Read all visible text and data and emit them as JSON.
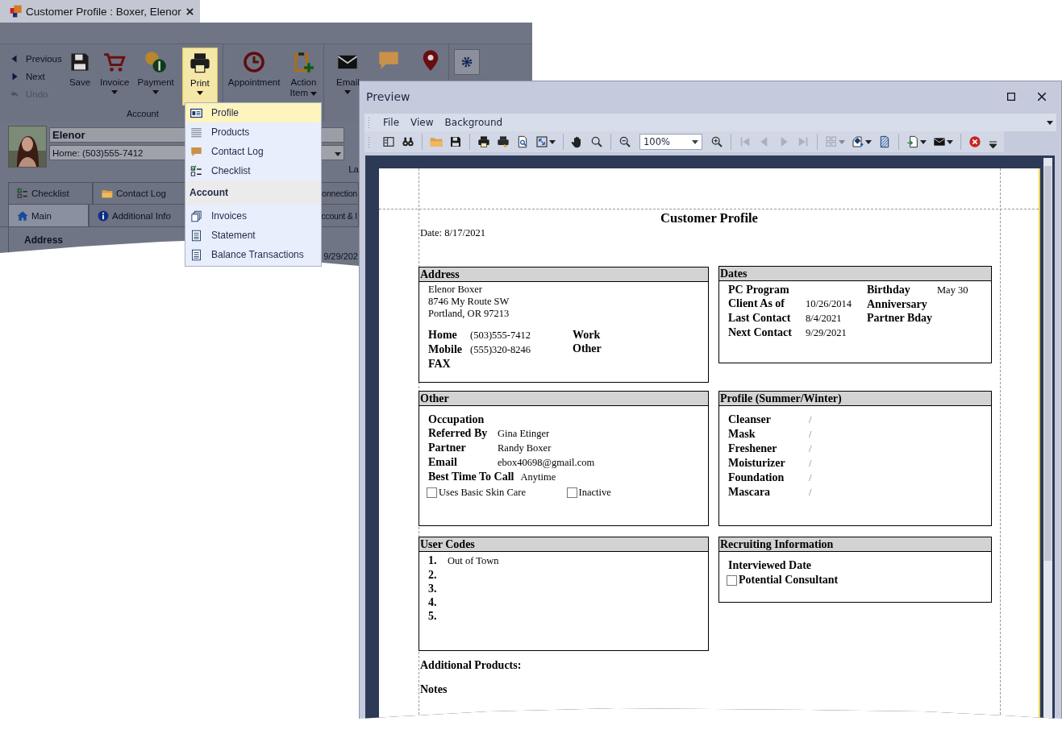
{
  "main_window": {
    "title": "Customer Profile : Boxer, Elenor",
    "nav": [
      {
        "kind": "triangle-left",
        "label": "Previous",
        "disabled": false
      },
      {
        "kind": "triangle-right",
        "label": "Next",
        "disabled": false
      },
      {
        "kind": "undo-arrow",
        "label": "Undo",
        "disabled": true
      }
    ],
    "ribbon_groups": [
      {
        "label": "Account",
        "buttons": [
          {
            "kind": "floppy",
            "label": "Save",
            "dropdown": false,
            "open": false
          },
          {
            "kind": "cart",
            "label": "Invoice",
            "dropdown": true,
            "open": false
          },
          {
            "kind": "coins",
            "label": "Payment",
            "dropdown": true,
            "open": false
          },
          {
            "kind": "printer",
            "label": "Print",
            "dropdown": true,
            "open": true
          }
        ]
      },
      {
        "buttons": [
          {
            "kind": "clock",
            "label": "Appointment",
            "dropdown": false,
            "open": false
          },
          {
            "kind": "clipboard-plus",
            "label": "Action Item",
            "dropdown": true,
            "open": false
          }
        ]
      },
      {
        "buttons": [
          {
            "kind": "envelope",
            "label": "Email",
            "dropdown": true,
            "open": false
          },
          {
            "kind": "speech-bubble",
            "dropdown": false,
            "open": false
          },
          {
            "kind": "map-pin",
            "dropdown": false,
            "open": false
          }
        ]
      },
      {
        "buttons": [
          {
            "kind": "gear",
            "dropdown": false,
            "open": false
          }
        ]
      }
    ],
    "print_menu": [
      {
        "kind": "item",
        "label": "Profile",
        "selected": true
      },
      {
        "kind": "item",
        "label": "Products",
        "selected": false
      },
      {
        "kind": "item",
        "label": "Contact Log",
        "selected": false
      },
      {
        "kind": "item",
        "label": "Checklist",
        "selected": false
      },
      {
        "kind": "header",
        "label": "Account"
      },
      {
        "kind": "item",
        "label": "Invoices",
        "selected": false
      },
      {
        "kind": "item",
        "label": "Statement",
        "selected": false
      },
      {
        "kind": "item",
        "label": "Balance Transactions",
        "selected": false
      }
    ],
    "customer": {
      "name": "Elenor",
      "phone": "Home: (503)555-7412",
      "side_label": "La",
      "date_value": "9/29/202"
    },
    "tabs_row_1": [
      {
        "label": "Checklist",
        "selected": false
      },
      {
        "label": "Contact Log",
        "selected": false
      },
      {
        "label": "onnection",
        "selected": false
      }
    ],
    "tabs_row_2": [
      {
        "label": "Main",
        "selected": true
      },
      {
        "label": "Additional Info",
        "selected": false
      },
      {
        "label": "ccount & I",
        "selected": false
      }
    ],
    "group_title": "Address"
  },
  "preview": {
    "title": "Preview",
    "menu": [
      "File",
      "View",
      "Background"
    ],
    "zoom": "100%",
    "toolbar": [
      [
        {
          "kind": "panel-layout",
          "disabled": false,
          "dropdown": false
        },
        {
          "kind": "binoculars",
          "disabled": false,
          "dropdown": false
        }
      ],
      [
        {
          "kind": "folder",
          "disabled": false,
          "dropdown": false
        },
        {
          "kind": "floppy",
          "disabled": false,
          "dropdown": false
        }
      ],
      [
        {
          "kind": "printer",
          "disabled": false,
          "dropdown": false
        },
        {
          "kind": "printer-arrow",
          "disabled": false,
          "dropdown": false
        },
        {
          "kind": "page-magnifier",
          "disabled": false,
          "dropdown": false
        },
        {
          "kind": "resize-frame",
          "disabled": false,
          "dropdown": true
        }
      ],
      [
        {
          "kind": "hand",
          "disabled": false,
          "dropdown": false
        },
        {
          "kind": "magnifier",
          "disabled": false,
          "dropdown": false
        }
      ],
      [
        {
          "kind": "zoom-out",
          "disabled": false,
          "dropdown": false
        },
        {
          "kind": "zoom-field",
          "disabled": false,
          "dropdown": true
        },
        {
          "kind": "zoom-in",
          "disabled": false,
          "dropdown": false
        }
      ],
      [
        {
          "kind": "skip-first",
          "disabled": true,
          "dropdown": false
        },
        {
          "kind": "triangle-left",
          "disabled": true,
          "dropdown": false
        },
        {
          "kind": "triangle-right",
          "disabled": true,
          "dropdown": false
        },
        {
          "kind": "skip-last",
          "disabled": true,
          "dropdown": false
        }
      ],
      [
        {
          "kind": "page-grid",
          "disabled": true,
          "dropdown": true
        },
        {
          "kind": "fill-bucket",
          "disabled": false,
          "dropdown": true
        },
        {
          "kind": "hatched-page",
          "disabled": false,
          "dropdown": false
        }
      ],
      [
        {
          "kind": "page-arrow",
          "disabled": false,
          "dropdown": true
        },
        {
          "kind": "envelope",
          "disabled": false,
          "dropdown": true
        }
      ],
      [
        {
          "kind": "close-circle",
          "disabled": false,
          "dropdown": false
        }
      ]
    ],
    "report": {
      "title": "Customer Profile",
      "date": "Date: 8/17/2021",
      "address": {
        "heading": "Address",
        "lines": [
          "Elenor Boxer",
          "8746 My Route SW",
          "Portland, OR 97213"
        ],
        "phones": [
          {
            "label": "Home",
            "value": "(503)555-7412"
          },
          {
            "label": "Mobile",
            "value": "(555)320-8246"
          },
          {
            "label": "FAX"
          }
        ],
        "phones_right": [
          {
            "label": "Work"
          },
          {
            "label": "Other"
          }
        ]
      },
      "dates": {
        "heading": "Dates",
        "left": [
          {
            "label": "PC Program"
          },
          {
            "label": "Client As of",
            "value": "10/26/2014"
          },
          {
            "label": "Last Contact",
            "value": "8/4/2021"
          },
          {
            "label": "Next Contact",
            "value": "9/29/2021"
          }
        ],
        "right": [
          {
            "label": "Birthday",
            "value": "May 30"
          },
          {
            "label": "Anniversary"
          },
          {
            "label": "Partner Bday"
          }
        ]
      },
      "other": {
        "heading": "Other",
        "fields": [
          {
            "label": "Occupation"
          },
          {
            "label": "Referred By",
            "value": "Gina Etinger"
          },
          {
            "label": "Partner",
            "value": "Randy Boxer"
          },
          {
            "label": "Email",
            "value": "ebox40698@gmail.com"
          },
          {
            "label": "Best Time To Call",
            "value": "Anytime"
          }
        ],
        "checkboxes": [
          {
            "label": "Uses Basic Skin Care",
            "checked": false
          },
          {
            "label": "Inactive",
            "checked": false
          }
        ]
      },
      "profile": {
        "heading": "Profile (Summer/Winter)",
        "rows": [
          {
            "label": "Cleanser",
            "value": "/"
          },
          {
            "label": "Mask",
            "value": "/"
          },
          {
            "label": "Freshener",
            "value": "/"
          },
          {
            "label": "Moisturizer",
            "value": "/"
          },
          {
            "label": "Foundation",
            "value": "/"
          },
          {
            "label": "Mascara",
            "value": "/"
          }
        ]
      },
      "user_codes": {
        "heading": "User Codes",
        "rows": [
          {
            "number": "1.",
            "value": "Out of Town"
          },
          {
            "number": "2."
          },
          {
            "number": "3."
          },
          {
            "number": "4."
          },
          {
            "number": "5."
          }
        ]
      },
      "recruiting": {
        "heading": "Recruiting Information",
        "fields": [
          {
            "label": "Interviewed Date"
          }
        ],
        "checkboxes": [
          {
            "label": "Potential Consultant",
            "checked": false
          }
        ]
      },
      "additional_products": "Additional Products:",
      "notes": "Notes"
    }
  }
}
